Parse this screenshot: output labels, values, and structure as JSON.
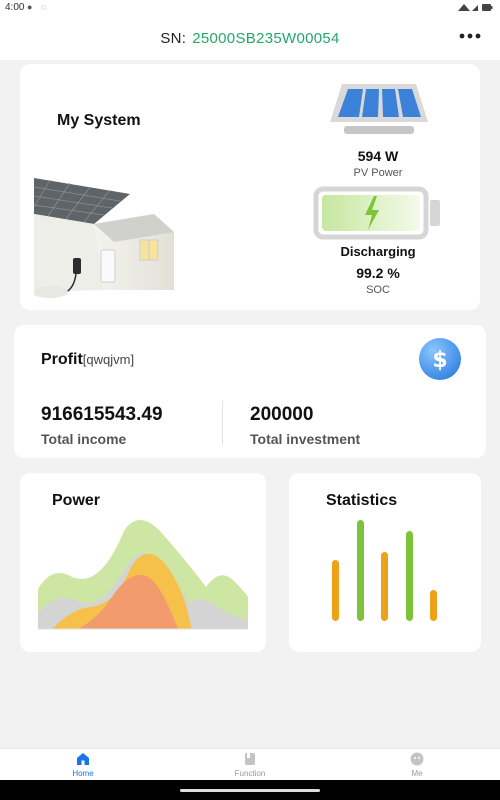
{
  "status_bar": {
    "time": "4:00"
  },
  "header": {
    "sn_label": "SN:",
    "sn_value": "25000SB235W00054"
  },
  "system": {
    "title": "My System",
    "pv_value": "594 W",
    "pv_label": "PV Power",
    "battery_status": "Discharging",
    "soc_value": "99.2 %",
    "soc_label": "SOC"
  },
  "profit": {
    "title": "Profit",
    "currency": "[qwqjvm]",
    "income_value": "916615543.49",
    "income_label": "Total income",
    "investment_value": "200000",
    "investment_label": "Total investment"
  },
  "power_card": {
    "title": "Power"
  },
  "stats_card": {
    "title": "Statistics"
  },
  "nav": [
    {
      "label": "Home",
      "icon": "home-icon",
      "active": true
    },
    {
      "label": "Function",
      "icon": "function-icon",
      "active": false
    },
    {
      "label": "Me",
      "icon": "me-icon",
      "active": false
    }
  ],
  "colors": {
    "sn_green": "#21a86b",
    "nav_active": "#1a73e8",
    "battery_green": "#7cc43a",
    "stats_orange": "#f0a11a",
    "stats_green": "#7cc43a"
  }
}
